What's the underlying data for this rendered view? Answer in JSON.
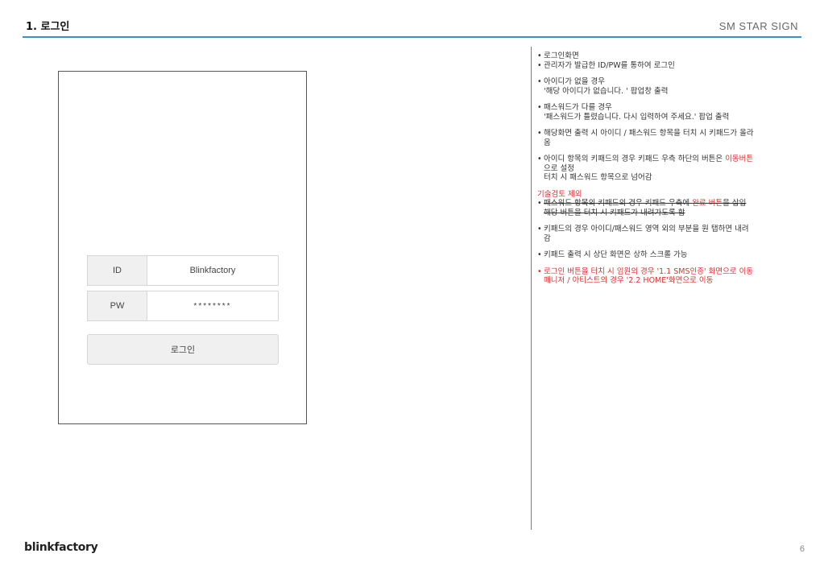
{
  "header": {
    "title": "1. 로그인",
    "brand": "SM STAR SIGN"
  },
  "device": {
    "id_label": "ID",
    "id_value": "Blinkfactory",
    "pw_label": "PW",
    "pw_value": "********",
    "login_button": "로그인"
  },
  "notes": {
    "n1_l1": "로그인화면",
    "n1_l2": "관리자가 발급한 ID/PW를 통하여 로그인",
    "n2_l1": "아이디가 없을 경우",
    "n2_l2": "'해당 아이디가 없습니다. ' 팝업창 출력",
    "n3_l1": "패스워드가 다를 경우",
    "n3_l2": "'패스워드가 틀렸습니다. 다시 입력하여 주세요.' 팝업 출력",
    "n4_l1": "해당화면 출력 시 아이디 / 패스워드 항목을 터치 시 키패드가 올라",
    "n4_l2": "옴",
    "n5_l1a": "아이디 항목의 키패드의 경우 키패드 우측 하단의 버튼은 ",
    "n5_l1b": "이동버튼",
    "n5_l2": "으로 설정",
    "n5_l3": "터치 시 패스워드 항목으로 넘어감",
    "n6_head": "기술검토 제외",
    "n6_l1a": "패스워드 항목의 키패드의 경우 키패드 우측에 ",
    "n6_l1b": "완료 버튼",
    "n6_l1c": "을 삽입",
    "n6_l2": "해당 버튼을 터치 시 키패드가 내려가도록 함",
    "n7_l1": "키패드의 경우 아이디/패스워드 영역 외의 부분을 원 탭하면 내려",
    "n7_l2": "감",
    "n8_l1": "키패드 출력 시 상단 화면은 상하 스크롤 가능",
    "n9_l1": "로그인 버튼을 터치 시 임원의 경우 '1.1 SMS인증' 화면으로 이동",
    "n9_l2": "매니저 / 아티스트의 경우 '2.2 HOME'화면으로 이동"
  },
  "footer": {
    "logo": "blinkfactory",
    "page_number": "6"
  },
  "colors": {
    "accent": "#3d8ec9",
    "highlight": "#e03030"
  }
}
